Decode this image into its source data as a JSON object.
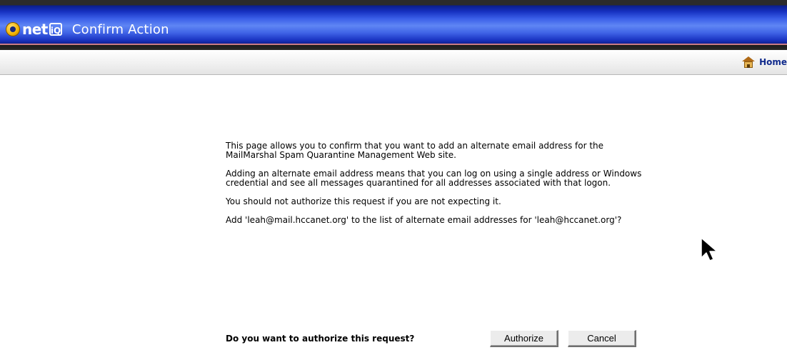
{
  "header": {
    "logo_text": "net",
    "logo_badge": "iQ",
    "title": "Confirm Action"
  },
  "toolbar": {
    "home_label": "Home"
  },
  "content": {
    "paragraphs": [
      "This page allows you to confirm that you want to add an alternate email address for the MailMarshal Spam Quarantine Management Web site.",
      "Adding an alternate email address means that you can log on using a single address or Windows credential and see all messages quarantined for all addresses associated with that logon.",
      "You should not authorize this request if you are not expecting it.",
      "Add 'leah@mail.hccanet.org' to the list of alternate email addresses for 'leah@hccanet.org'?"
    ]
  },
  "confirm": {
    "prompt": "Do you want to authorize this request?",
    "authorize_label": "Authorize",
    "cancel_label": "Cancel"
  },
  "icons": {
    "logo": "logo-icon",
    "home": "home-icon",
    "cursor": "mouse-cursor-icon"
  }
}
